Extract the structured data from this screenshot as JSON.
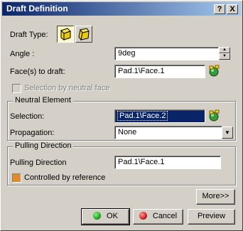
{
  "window": {
    "title": "Draft Definition",
    "help_label": "?",
    "close_label": "X"
  },
  "draft_type": {
    "label": "Draft Type:",
    "options": [
      "draft-face-icon",
      "draft-reflect-icon"
    ]
  },
  "angle": {
    "label": "Angle :",
    "value": "9deg"
  },
  "faces": {
    "label": "Face(s) to draft:",
    "value": "Pad.1\\Face.1"
  },
  "selection_by_neutral_face": {
    "label": "Selection by neutral face",
    "checked": false,
    "enabled": false
  },
  "neutral_element": {
    "title": "Neutral Element",
    "selection_label": "Selection:",
    "selection_value": "Pad.1\\Face.2",
    "propagation_label": "Propagation:",
    "propagation_value": "None"
  },
  "pulling_direction": {
    "title": "Pulling Direction",
    "label": "Pulling Direction",
    "value": "Pad.1\\Face.1",
    "controlled_label": "Controlled by reference",
    "controlled_checked": true
  },
  "buttons": {
    "more": "More>>",
    "ok": "OK",
    "cancel": "Cancel",
    "preview": "Preview"
  },
  "colors": {
    "title_start": "#0a246a",
    "title_end": "#a6caf0",
    "ok_green": "#1aa81a",
    "cancel_red": "#d02020",
    "checkbox_orange": "#e08a2c"
  }
}
